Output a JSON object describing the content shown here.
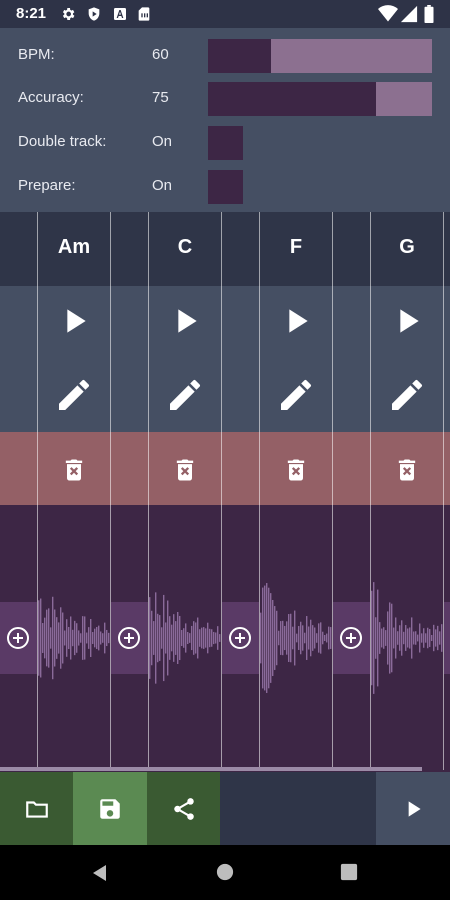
{
  "status_bar": {
    "time": "8:21",
    "left_icons": [
      "gear-icon",
      "shield-icon",
      "font-icon",
      "sim-card-icon"
    ],
    "right_icons": [
      "wifi-icon",
      "signal-icon",
      "battery-icon"
    ]
  },
  "settings": {
    "bpm": {
      "label": "BPM:",
      "value": "60",
      "level": 0.28
    },
    "accuracy": {
      "label": "Accuracy:",
      "value": "75",
      "level": 0.75
    },
    "double_track": {
      "label": "Double track:",
      "value": "On"
    },
    "prepare": {
      "label": "Prepare:",
      "value": "On"
    }
  },
  "chords": [
    {
      "name": "Am"
    },
    {
      "name": "C"
    },
    {
      "name": "F"
    },
    {
      "name": "G"
    }
  ],
  "toolbar": {
    "open_icon": "folder-icon",
    "save_icon": "save-icon",
    "share_icon": "share-icon",
    "play_icon": "play-icon"
  },
  "navigation": [
    "back-icon",
    "home-icon",
    "recents-icon"
  ],
  "colors": {
    "settings_bg": "#454f63",
    "chord_row_bg": "#2f3548",
    "delete_row_bg": "#946066",
    "wave_bg": "#3d2645",
    "slider_fill": "#3d2645",
    "slider_track": "#8c7090",
    "toolbar_open": "#3a5a32",
    "toolbar_save": "#5b8a52",
    "toolbar_share": "#3a5a32"
  }
}
